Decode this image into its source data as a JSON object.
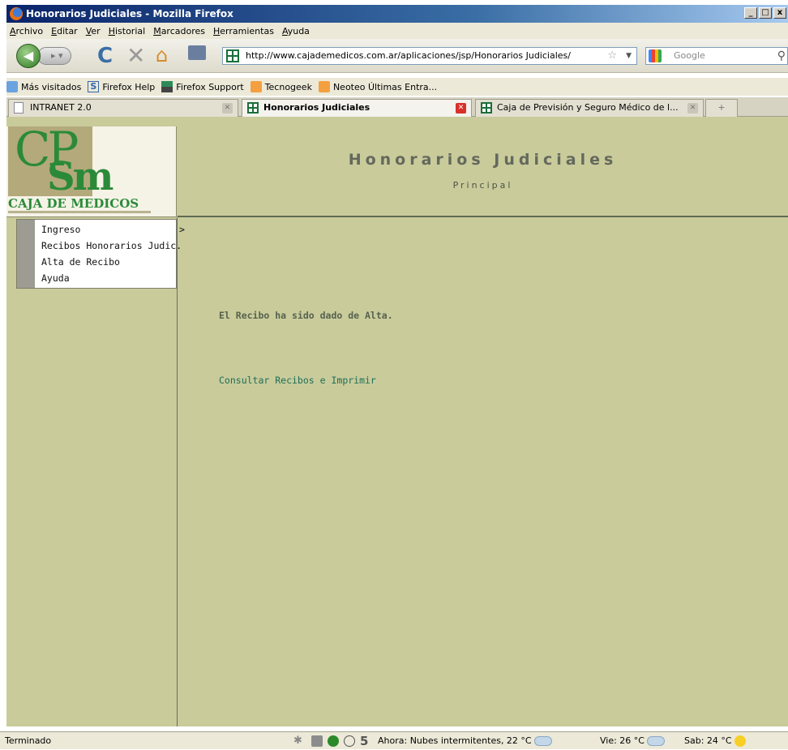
{
  "window": {
    "title": "Honorarios Judiciales - Mozilla Firefox",
    "controls": [
      "_",
      "□",
      "x"
    ]
  },
  "menubar": [
    "Archivo",
    "Editar",
    "Ver",
    "Historial",
    "Marcadores",
    "Herramientas",
    "Ayuda"
  ],
  "navigation": {
    "url": "http://www.cajademedicos.com.ar/aplicaciones/jsp/Honorarios Judiciales/",
    "search_placeholder": "Google"
  },
  "bookmarks": [
    "Más visitados",
    "Firefox Help",
    "Firefox Support",
    "Tecnogeek",
    "Neoteo Últimas Entra..."
  ],
  "tabs": [
    {
      "label": "INTRANET 2.0",
      "active": false
    },
    {
      "label": "Honorarios Judiciales",
      "active": true
    },
    {
      "label": "Caja de Previsión y Seguro Médico de l...",
      "active": false
    }
  ],
  "logo": {
    "name": "CAJA DE MEDICOS"
  },
  "page": {
    "title": "Honorarios Judiciales",
    "subtitle": "Principal",
    "message": "El Recibo ha sido dado de Alta.",
    "link": "Consultar Recibos e Imprimir"
  },
  "menu": [
    {
      "label": "Ingreso",
      "arrow": ">"
    },
    {
      "label": "Recibos Honorarios Judic."
    },
    {
      "label": "Alta de Recibo"
    },
    {
      "label": "Ayuda"
    }
  ],
  "statusbar": {
    "status": "Terminado",
    "counter": "5",
    "weather_now": "Ahora: Nubes intermitentes, 22 °C",
    "weather_fri": "Vie: 26 °C",
    "weather_sat": "Sab: 24 °C"
  }
}
